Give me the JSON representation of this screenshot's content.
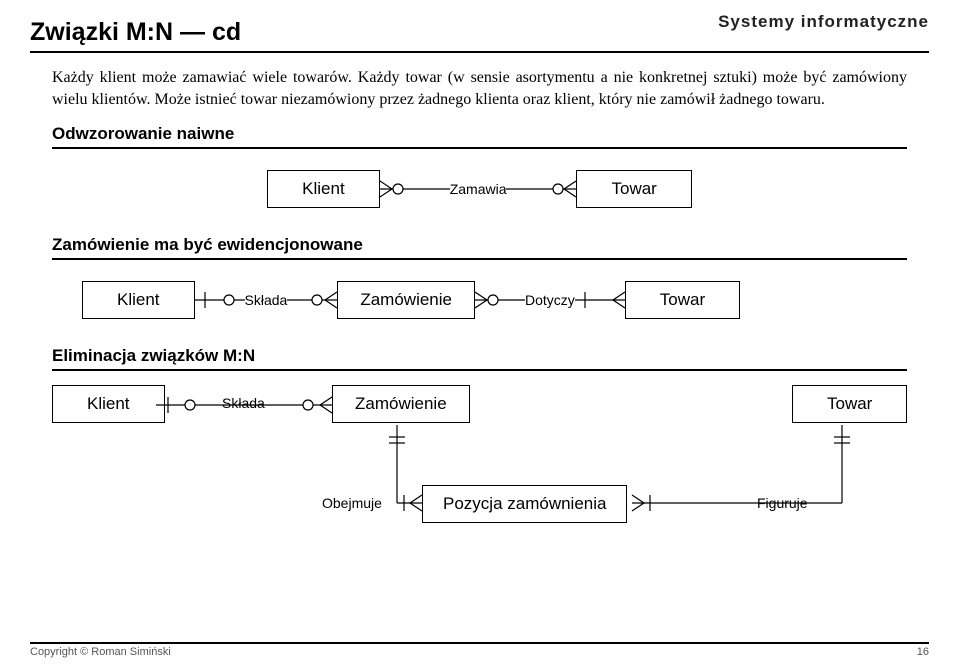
{
  "header": {
    "label": "Systemy informatyczne"
  },
  "title": "Związki M:N — cd",
  "paragraph": "Każdy klient może zamawiać wiele towarów. Każdy towar (w sensie asortymentu a nie konkretnej sztuki) może być zamówiony wielu klientów. Może istnieć towar niezamówiony przez żadnego klienta oraz klient, który nie zamówił żadnego towaru.",
  "sections": {
    "naive": "Odwzorowanie naiwne",
    "recorded": "Zamówienie ma być ewidencjonowane",
    "elim": "Eliminacja związków M:N"
  },
  "diag1": {
    "e1": "Klient",
    "rel": "Zamawia",
    "e2": "Towar"
  },
  "diag2": {
    "e1": "Klient",
    "r1": "Składa",
    "e2": "Zamówienie",
    "r2": "Dotyczy",
    "e3": "Towar"
  },
  "diag3": {
    "e1": "Klient",
    "r1": "Składa",
    "e2": "Zamówienie",
    "e3": "Towar",
    "r2": "Obejmuje",
    "e4": "Pozycja zamównienia",
    "r3": "Figuruje"
  },
  "footer": {
    "copyright": "Copyright © Roman Simiński",
    "page": "16"
  }
}
